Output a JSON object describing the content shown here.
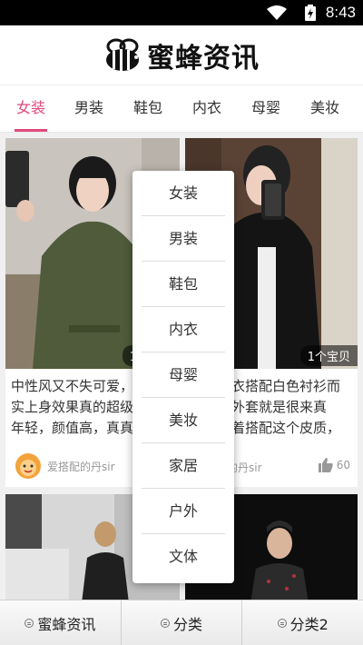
{
  "status_bar": {
    "time": "8:43"
  },
  "header": {
    "logo_text": "蜜蜂资讯"
  },
  "tabs": [
    {
      "label": "女装",
      "active": true
    },
    {
      "label": "男装"
    },
    {
      "label": "鞋包"
    },
    {
      "label": "内衣"
    },
    {
      "label": "母婴"
    },
    {
      "label": "美妆"
    }
  ],
  "cards": [
    {
      "badge": "1个宝贝",
      "desc": "中性风又不失可爱，裙子其实上身效果真的超级减龄显年轻，颜值高，真真的是谁能不爱呢。",
      "author": "爱搭配的丹sir",
      "likes": ""
    },
    {
      "badge": "1个宝贝",
      "desc": "黑色皮衣搭配白色衬衫而来衬衫外套就是很来真的，穿着搭配这个皮质，真真的是woman平衡结合。…",
      "author": "爱搭配的丹sir",
      "likes": "60"
    }
  ],
  "dropdown": {
    "items": [
      "女装",
      "男装",
      "鞋包",
      "内衣",
      "母婴",
      "美妆",
      "家居",
      "户外",
      "文体"
    ]
  },
  "bottom_nav": {
    "items": [
      "蜜蜂资讯",
      "分类",
      "分类2"
    ]
  }
}
